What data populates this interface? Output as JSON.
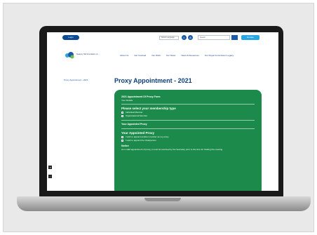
{
  "topbar": {
    "login_label": "Login",
    "language_label": "Select Language",
    "search_placeholder": "Search",
    "donate_label": "Donate"
  },
  "logo": {
    "text": "Seabury Hall Foundation of ..."
  },
  "nav": {
    "items": [
      "About Us",
      "Get Involved",
      "Our Work",
      "Our News",
      "News & Resources",
      "Our Royal Commission Legacy"
    ]
  },
  "breadcrumb": "Proxy Appointment - 2021",
  "page": {
    "title": "Proxy Appointment - 2021"
  },
  "form": {
    "heading": "2021 Appointment Of Proxy Form",
    "subheading": "Your Details",
    "membership_title": "Please select your membership type",
    "membership_options": [
      "Individual Member",
      "Organisational Member"
    ],
    "appointed_proxy_label": "Your Appointed Proxy",
    "appointed_proxy_title": "Your Appointed Proxy",
    "proxy_options": [
      "I wish to appoint another member as my proxy",
      "I wish to appoint the Chairperson"
    ],
    "notice_title": "Notice",
    "notice_text": "As a valid appointment of proxy, it must be received by the Secretary prior to the time for holding the meeting"
  },
  "colors": {
    "form_green": "#1c8a4a",
    "brand_blue": "#0c3f7a",
    "accent": "#2aa6e0"
  }
}
